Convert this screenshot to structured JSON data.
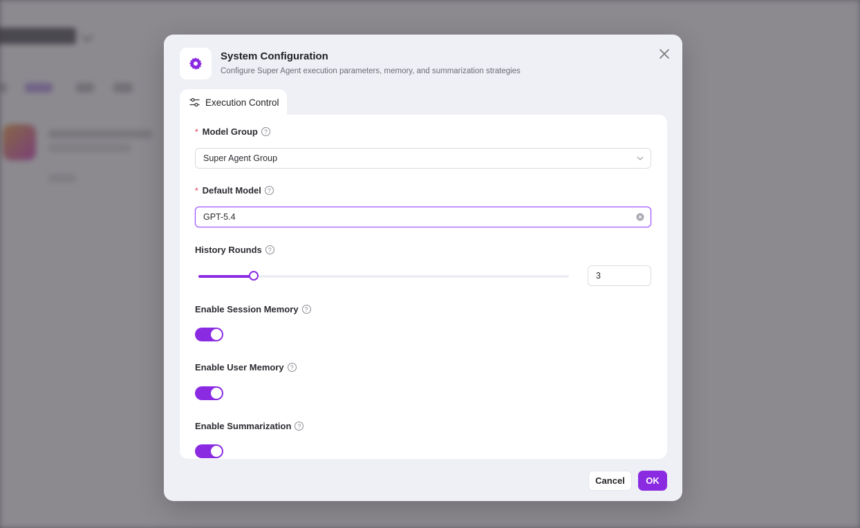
{
  "dialog": {
    "title": "System Configuration",
    "subtitle": "Configure Super Agent execution parameters, memory, and summarization strategies",
    "icon": "gear-icon",
    "close_icon": "close-icon"
  },
  "tabs": [
    {
      "label": "Execution Control",
      "icon": "sliders-icon",
      "active": true
    }
  ],
  "form": {
    "model_group": {
      "label": "Model Group",
      "required": true,
      "value": "Super Agent Group",
      "icon": "chevron-down-icon"
    },
    "default_model": {
      "label": "Default Model",
      "required": true,
      "value": "GPT-5.4",
      "icon": "clear-icon"
    },
    "history_rounds": {
      "label": "History Rounds",
      "value": "3",
      "slider_fraction": 0.15
    },
    "session_memory": {
      "label": "Enable Session Memory",
      "enabled": true
    },
    "user_memory": {
      "label": "Enable User Memory",
      "enabled": true
    },
    "summarization": {
      "label": "Enable Summarization",
      "enabled": true
    }
  },
  "footer": {
    "cancel_label": "Cancel",
    "ok_label": "OK"
  },
  "colors": {
    "accent": "#8a2be2",
    "required": "#e0304a"
  }
}
